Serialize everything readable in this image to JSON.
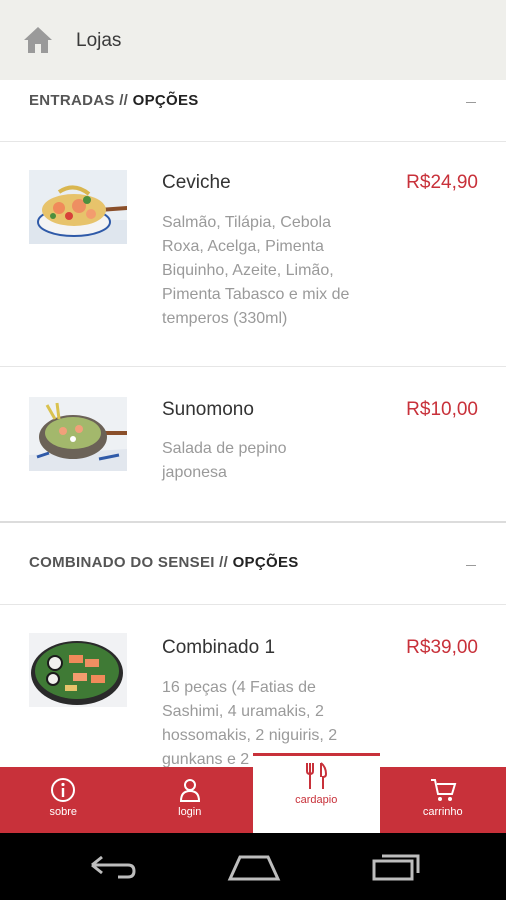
{
  "topbar": {
    "title": "Lojas",
    "icon": "home-icon"
  },
  "sections": [
    {
      "title": "ENTRADAS",
      "separator": " // ",
      "options_label": "OPÇÕES",
      "items": [
        {
          "name": "Ceviche",
          "price": "R$24,90",
          "description": "Salmão, Tilápia, Cebola Roxa, Acelga, Pimenta Biquinho, Azeite, Limão, Pimenta Tabasco e mix de temperos (330ml)"
        },
        {
          "name": "Sunomono",
          "price": "R$10,00",
          "description": "Salada de pepino japonesa"
        }
      ]
    },
    {
      "title": "COMBINADO DO SENSEI",
      "separator": " // ",
      "options_label": "OPÇÕES",
      "items": [
        {
          "name": "Combinado 1",
          "price": "R$39,00",
          "description": "16 peças (4 Fatias de Sashimi, 4 uramakis, 2 hossomakis, 2 niguiris, 2 gunkans e 2"
        }
      ]
    }
  ],
  "bottom_nav": [
    {
      "label": "sobre",
      "icon": "info-icon",
      "active": false
    },
    {
      "label": "login",
      "icon": "user-icon",
      "active": false
    },
    {
      "label": "cardapio",
      "icon": "cutlery-icon",
      "active": true
    },
    {
      "label": "carrinho",
      "icon": "cart-icon",
      "active": false
    }
  ],
  "colors": {
    "accent": "#c8313a",
    "topbar_bg": "#efefeb",
    "text_muted": "#9a9a9a"
  }
}
